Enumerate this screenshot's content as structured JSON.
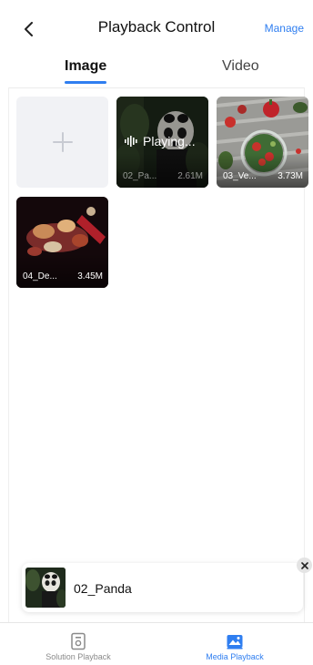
{
  "header": {
    "title": "Playback Control",
    "manage_label": "Manage",
    "back_icon": "chevron-left-icon"
  },
  "tabs": [
    {
      "label": "Image",
      "active": true
    },
    {
      "label": "Video",
      "active": false
    }
  ],
  "media": {
    "add_icon": "plus-icon",
    "items": [
      {
        "name": "02_Pa...",
        "size": "2.61M",
        "playing": true,
        "status": "Playing..."
      },
      {
        "name": "03_Ve...",
        "size": "3.73M",
        "playing": false
      },
      {
        "name": "04_De...",
        "size": "3.45M",
        "playing": false
      }
    ]
  },
  "mini_player": {
    "title": "02_Panda",
    "close_icon": "close-icon"
  },
  "bottom_nav": [
    {
      "label": "Solution Playback",
      "icon": "solution-playback-icon",
      "active": false
    },
    {
      "label": "Media Playback",
      "icon": "media-playback-icon",
      "active": true
    }
  ],
  "colors": {
    "accent": "#2f7ef0",
    "inactive": "#8a8a8a",
    "tile_placeholder": "#f1f2f5"
  }
}
